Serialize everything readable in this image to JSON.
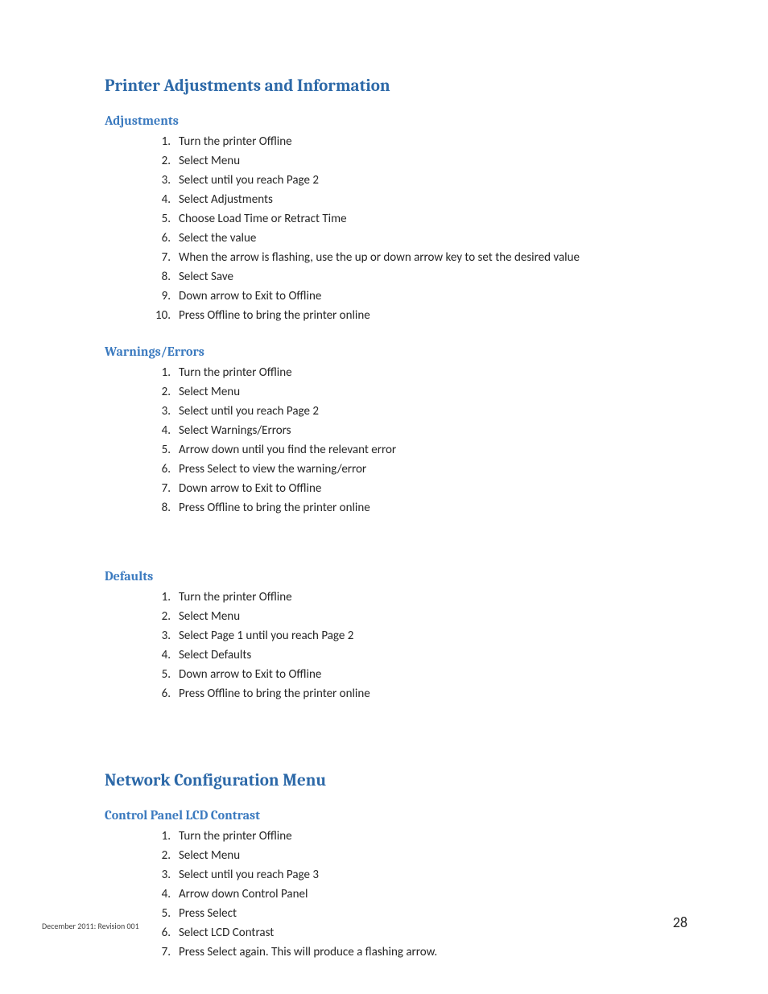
{
  "sections": [
    {
      "heading1": "Printer Adjustments and Information",
      "heading2": "Adjustments",
      "items": [
        "Turn the printer Offline",
        "Select Menu",
        "Select until you reach Page 2",
        "Select Adjustments",
        "Choose Load Time or Retract Time",
        "Select the value",
        "When the arrow is flashing, use the up or down arrow key to set the desired value",
        "Select Save",
        "Down arrow to Exit to Offline",
        "Press Offline to bring the printer online"
      ]
    },
    {
      "heading2": "Warnings/Errors",
      "items": [
        "Turn the printer Offline",
        "Select Menu",
        "Select until you reach Page 2",
        "Select Warnings/Errors",
        "Arrow down until you find the relevant error",
        "Press Select to view the warning/error",
        "Down arrow to Exit to Offline",
        "Press Offline to bring the printer online"
      ]
    },
    {
      "heading2": "Defaults",
      "gapBefore": true,
      "items": [
        "Turn the printer Offline",
        "Select Menu",
        "Select Page 1 until you reach Page 2",
        "Select Defaults",
        "Down arrow to Exit to Offline",
        "Press Offline to bring the printer online"
      ]
    },
    {
      "heading1": "Network Configuration Menu",
      "heading2": "Control Panel LCD Contrast",
      "gapBeforeLarge": true,
      "items": [
        "Turn the printer Offline",
        "Select Menu",
        "Select  until you reach Page 3",
        "Arrow down Control Panel",
        "Press Select",
        "Select LCD Contrast",
        "Press Select again.  This will produce a flashing arrow."
      ]
    }
  ],
  "footer": {
    "left": "December 2011: Revision 001",
    "right": "28"
  }
}
